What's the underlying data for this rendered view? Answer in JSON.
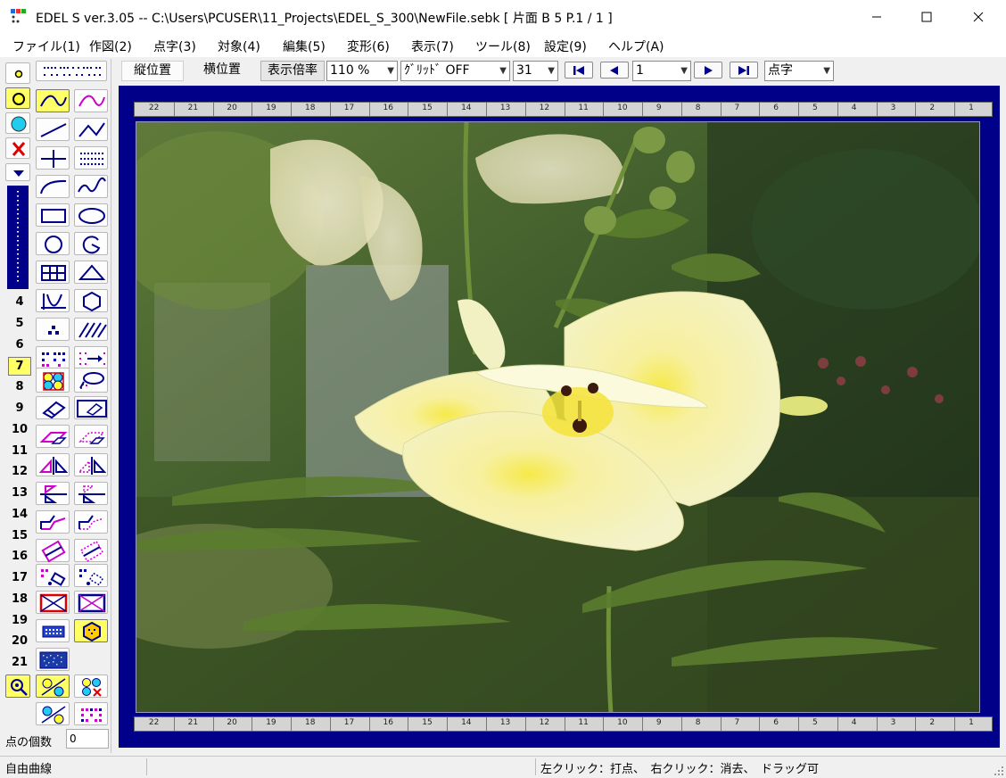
{
  "window": {
    "title": "EDEL S  ver.3.05 -- C:\\Users\\PCUSER\\11_Projects\\EDEL_S_300\\NewFile.sebk  [ 片面    B 5     P.1 / 1 ]",
    "controls": [
      "minimize-icon",
      "maximize-icon",
      "close-icon"
    ]
  },
  "menu": {
    "items": [
      "ファイル(1)",
      "作図(2)",
      "点字(3)",
      "対象(4)",
      "編集(5)",
      "変形(6)",
      "表示(7)",
      "ツール(8)",
      "設定(9)",
      "ヘルプ(A)"
    ]
  },
  "toolbar": {
    "vertical_position": "縦位置",
    "horizontal_position": "横位置",
    "zoom_label": "表示倍率",
    "zoom_value": "110 %",
    "grid_value": "ｸﾞﾘｯﾄﾞ OFF",
    "size_value": "31",
    "page_value": "1",
    "mode_value": "点字",
    "nav_icons": [
      "first-page-icon",
      "prev-page-icon",
      "next-page-icon",
      "last-page-icon"
    ]
  },
  "left_panel": {
    "line_numbers": [
      "4",
      "5",
      "6",
      "7",
      "8",
      "9",
      "10",
      "11",
      "12",
      "13",
      "14",
      "15",
      "16",
      "17",
      "18",
      "19",
      "20",
      "21"
    ],
    "selected_line_number": "7",
    "point_count_label": "点の個数",
    "point_count_value": "0"
  },
  "rulers": {
    "labels": [
      "22",
      "21",
      "20",
      "19",
      "18",
      "17",
      "16",
      "15",
      "14",
      "13",
      "12",
      "11",
      "10",
      "9",
      "8",
      "7",
      "6",
      "5",
      "4",
      "3",
      "2",
      "1"
    ]
  },
  "status": {
    "mode": "自由曲線",
    "hint": "左クリック：打点、　右クリック：消去、　ドラッグ可"
  },
  "colors": {
    "canvas_border": "#000088",
    "selected_tool": "#ffff66",
    "braille_dot": "#0000aa",
    "accent_magenta": "#cc00cc",
    "accent_red": "#dd0000"
  }
}
